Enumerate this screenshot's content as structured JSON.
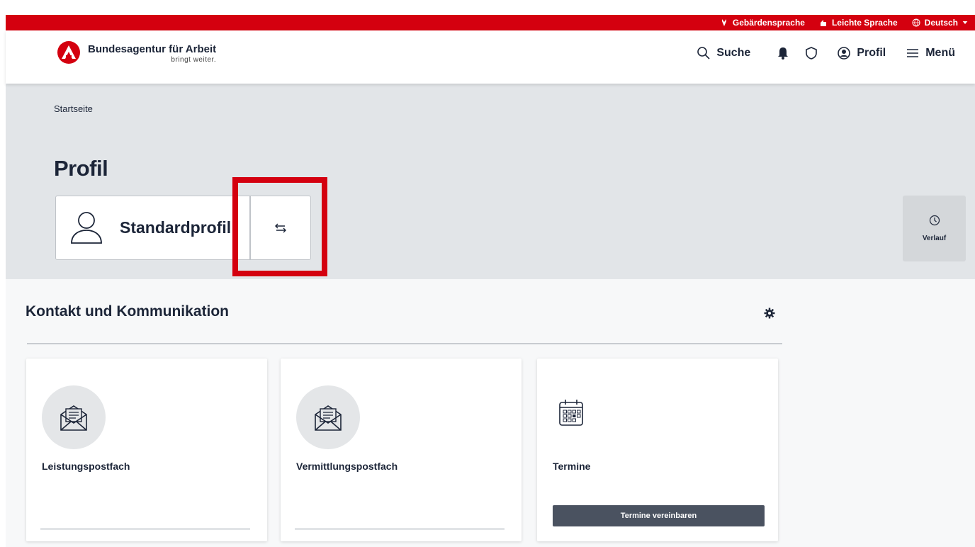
{
  "topbar": {
    "links": [
      {
        "label": "Gebärdensprache",
        "icon": "sign-language-icon"
      },
      {
        "label": "Leichte Sprache",
        "icon": "easy-language-icon"
      },
      {
        "label": "Deutsch",
        "icon": "globe-icon"
      }
    ]
  },
  "header": {
    "logo_name": "Bundesagentur für Arbeit",
    "logo_slogan": "bringt weiter.",
    "nav": {
      "search": "Suche",
      "profil": "Profil",
      "menu": "Menü"
    }
  },
  "hero": {
    "breadcrumb": "Startseite",
    "title": "Profil",
    "profile_name": "Standardprofil",
    "verlauf": "Verlauf"
  },
  "section": {
    "title": "Kontakt und Kommunikation",
    "cards": [
      {
        "label": "Leistungspostfach",
        "icon": "envelope-letter-icon"
      },
      {
        "label": "Vermittlungspostfach",
        "icon": "envelope-letter-icon"
      },
      {
        "label": "Termine",
        "icon": "calendar-icon",
        "action": "Termine vereinbaren"
      }
    ]
  },
  "colors": {
    "brand_red": "#d4000f",
    "dark_text": "#1c2538",
    "hero_bg": "#e2e5e8",
    "button_dark": "#4a5260"
  }
}
